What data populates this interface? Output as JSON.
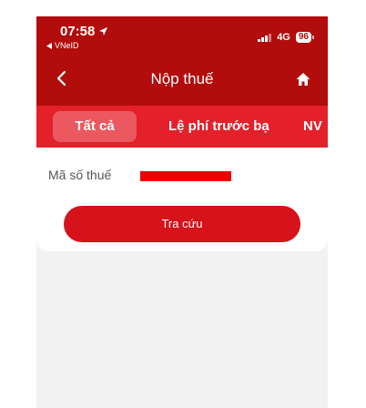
{
  "status_bar": {
    "time": "07:58",
    "back_app": "VNeID",
    "network": "4G",
    "battery": "96"
  },
  "header": {
    "title": "Nộp thuế"
  },
  "tabs": [
    {
      "label": "Tất cả",
      "active": true
    },
    {
      "label": "Lệ phí trước bạ",
      "active": false
    },
    {
      "label": "NV",
      "active": false
    }
  ],
  "form": {
    "tax_code_label": "Mã số thuế",
    "tax_code_value": "",
    "submit_label": "Tra cứu"
  },
  "colors": {
    "header_bg": "#b20c0c",
    "tabs_bg": "#e4202a",
    "button_bg": "#d6121b"
  }
}
